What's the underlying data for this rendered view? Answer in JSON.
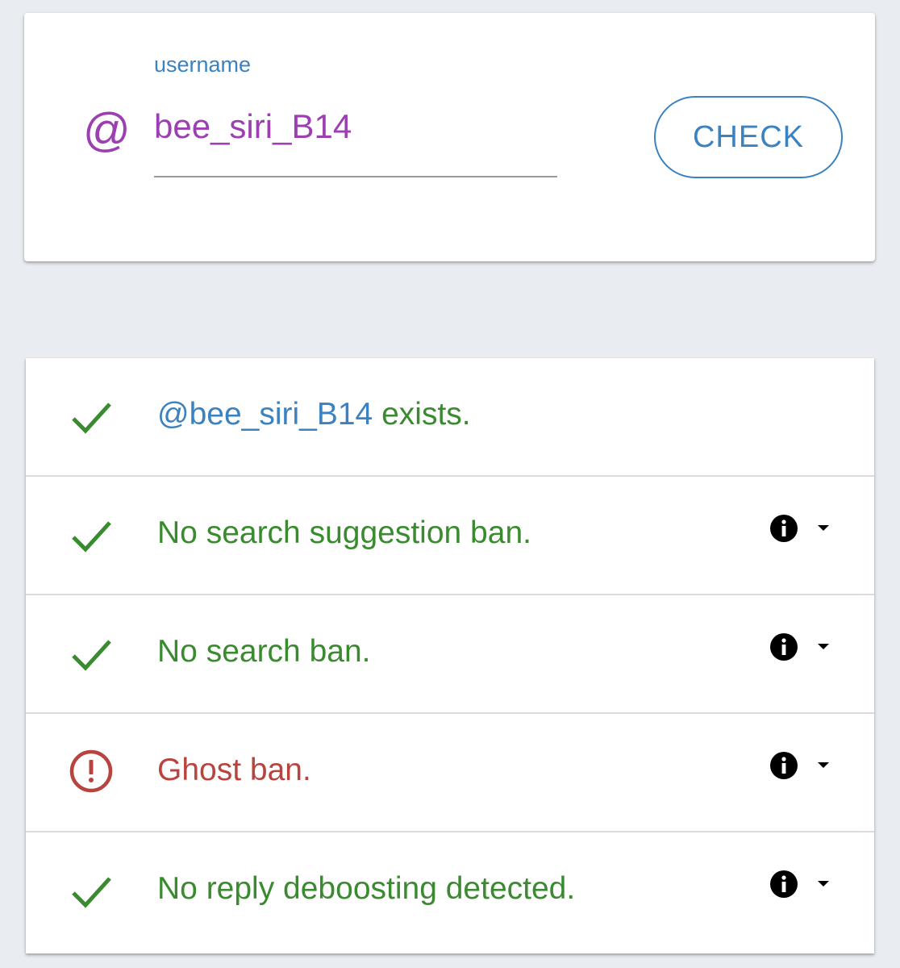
{
  "search": {
    "prefix_symbol": "@",
    "label": "username",
    "value": "bee_siri_B14",
    "check_button_label": "CHECK"
  },
  "results": {
    "exists": {
      "status": "ok",
      "status_icon": "checkmark-icon",
      "handle": "@bee_siri_B14",
      "suffix": " exists."
    },
    "rows": [
      {
        "status": "ok",
        "status_icon": "checkmark-icon",
        "text": "No search suggestion ban.",
        "info_icon": "info-icon",
        "expand_icon": "caret-down-icon"
      },
      {
        "status": "ok",
        "status_icon": "checkmark-icon",
        "text": "No search ban.",
        "info_icon": "info-icon",
        "expand_icon": "caret-down-icon"
      },
      {
        "status": "warning",
        "status_icon": "alert-circle-icon",
        "text": "Ghost ban.",
        "info_icon": "info-icon",
        "expand_icon": "caret-down-icon"
      },
      {
        "status": "ok",
        "status_icon": "checkmark-icon",
        "text": "No reply deboosting detected.",
        "info_icon": "info-icon",
        "expand_icon": "caret-down-icon"
      }
    ]
  },
  "colors": {
    "background": "#e9edf1",
    "accent_blue": "#3b82c0",
    "username_purple": "#9c3fb0",
    "ok_green": "#3a8a2f",
    "alert_red": "#b8443f"
  }
}
